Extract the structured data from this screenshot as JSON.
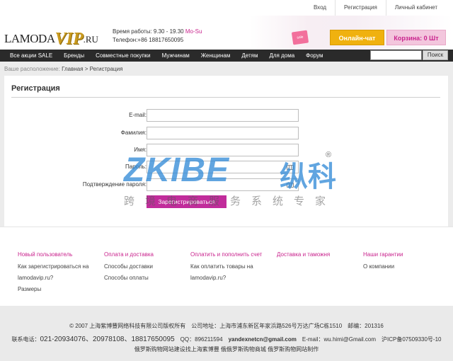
{
  "toplinks": {
    "login": "Вход",
    "register": "Регистрация",
    "cabinet": "Личный кабинет"
  },
  "logo": {
    "left": "LAMODA",
    "vip": "VIP",
    "domain": ".RU"
  },
  "hours": {
    "prefix": "Время работы: 9.30 - 19.30 ",
    "days": "Mo-Su",
    "phone": "Телефон:+86 18817650095"
  },
  "bag": {
    "label": "sale"
  },
  "header": {
    "chat": "Онлайн-чат",
    "cart": "Корзина: 0 Шт"
  },
  "nav": {
    "items": [
      "Все акции SALE",
      "Бренды",
      "Совместные покупки",
      "Мужчинам",
      "Женщинам",
      "Детям",
      "Для дома",
      "Форум"
    ],
    "search_value": "",
    "search_button": "Поиск"
  },
  "breadcrumb": {
    "label": "Ваше расположение: ",
    "home": "Главная",
    "sep": " > ",
    "current": "Регистрация"
  },
  "form": {
    "title": "Регистрация",
    "fields": [
      {
        "label": "E-mail:",
        "value": ""
      },
      {
        "label": "Фамилия:",
        "value": ""
      },
      {
        "label": "Имя:",
        "value": ""
      },
      {
        "label": "Пароль:",
        "value": ""
      },
      {
        "label": "Подтверждение пароля:",
        "value": ""
      }
    ],
    "submit": "Зарегистрироваться"
  },
  "watermark": {
    "brand": "ZKIBE",
    "cn": "纵科",
    "reg": "®",
    "tagline": "跨境电商服务系统专家"
  },
  "footer": {
    "columns": [
      {
        "heading": "Новый пользователь",
        "links": [
          "Как зарегистрироваться на lamodavip.ru?",
          "Размеры"
        ]
      },
      {
        "heading": "Оплата и доставка",
        "links": [
          "Способы доставки",
          "Способы оплаты"
        ]
      },
      {
        "heading": "Оплатить и пополнить счет",
        "links": [
          "Как оплатить товары на lamodavip.ru?"
        ]
      },
      {
        "heading": "Доставка и таможня",
        "links": []
      },
      {
        "heading": "Наши гарантии",
        "links": [
          "О компании"
        ]
      }
    ],
    "copyright": "© 2007 上海紫博豐网络科技有限公司版权所有　公司地址：上海市浦东新区年家浜路526号万达广场C栋1510　邮编：201316",
    "contact_label": "联系电话：",
    "phones": "021-20934076、20978108、18817650095",
    "qq_label": "　QQ：",
    "qq": "896211594　",
    "email1": "yandexnetcn@gmail.com",
    "email_label": "　E-mail：",
    "email2": "wu.himi@Gmail.com",
    "icp": "　沪ICP备07509330号-10",
    "credits": "俄罗斯购物网站建设找上海紫博豐 俄俄罗斯购物商城 俄罗斯购物网站制作"
  }
}
